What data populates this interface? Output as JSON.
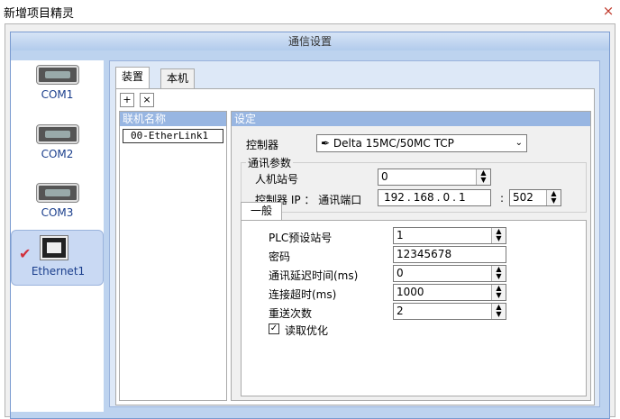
{
  "window": {
    "title": "新增项目精灵",
    "close_glyph": "×"
  },
  "group_title": "通信设置",
  "ports": [
    {
      "label": "COM1",
      "icon": "serial-port-icon"
    },
    {
      "label": "COM2",
      "icon": "serial-port-icon"
    },
    {
      "label": "COM3",
      "icon": "serial-port-icon"
    },
    {
      "label": "Ethernet1",
      "icon": "ethernet-port-icon",
      "selected": true
    }
  ],
  "tabs": {
    "device": "装置",
    "local": "本机"
  },
  "toolbar": {
    "add_glyph": "+",
    "delete_glyph": "×"
  },
  "link_panel": {
    "header": "联机名称",
    "items": [
      "00-EtherLink1"
    ]
  },
  "settings": {
    "header": "设定",
    "controller_label": "控制器",
    "controller_value": "Delta 15MC/50MC TCP",
    "comm_params_title": "通讯参数",
    "hmi_station_label": "人机站号",
    "hmi_station_value": "0",
    "controller_ip_label": "控制器 IP ： 通讯端口",
    "ip": [
      "192",
      "168",
      "0",
      "1"
    ],
    "ip_dot": ".",
    "port_sep": ":",
    "port_value": "502",
    "general_tab": "一般",
    "general": {
      "plc_station_label": "PLC预设站号",
      "plc_station_value": "1",
      "password_label": "密码",
      "password_value": "12345678",
      "delay_label": "通讯延迟时间(ms)",
      "delay_value": "0",
      "timeout_label": "连接超时(ms)",
      "timeout_value": "1000",
      "retry_label": "重送次数",
      "retry_value": "2",
      "read_opt_label": "读取优化",
      "read_opt_checked": true,
      "check_glyph": "✓"
    }
  },
  "colors": {
    "accent_blue": "#1a3e8c",
    "header_blue": "#98b6e2",
    "check_red": "#d1313c"
  }
}
